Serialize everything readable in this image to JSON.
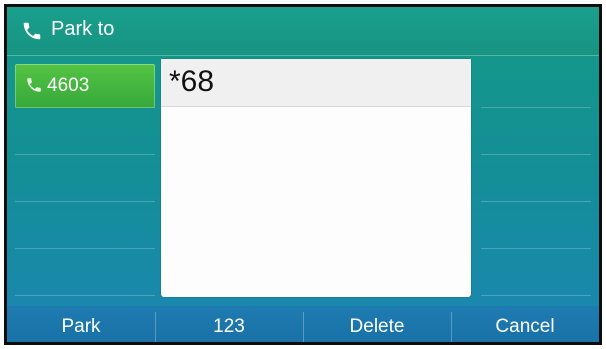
{
  "title": {
    "text": "Park to",
    "icon": "phone-icon"
  },
  "line_key": {
    "label": "4603",
    "icon": "phone-icon",
    "color": "#47b93f"
  },
  "dialog": {
    "input_value": "*68"
  },
  "softkeys": [
    {
      "label": "Park"
    },
    {
      "label": "123"
    },
    {
      "label": "Delete"
    },
    {
      "label": "Cancel"
    }
  ],
  "colors": {
    "background": "#179382",
    "softkey_bar": "#1b75aa",
    "dialog": "#fdfdfd"
  }
}
